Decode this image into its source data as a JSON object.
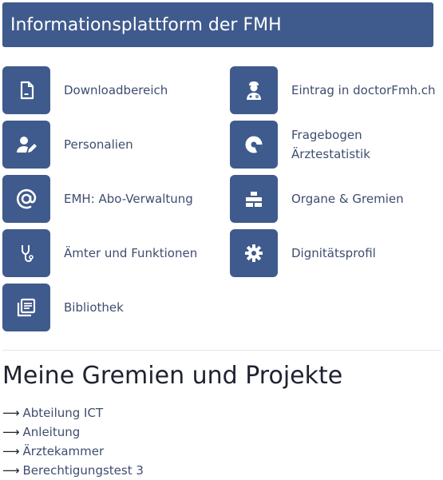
{
  "header": {
    "title": "Informationsplattform der FMH"
  },
  "tiles": [
    {
      "label": "Downloadbereich",
      "icon": "file-icon"
    },
    {
      "label": "Eintrag in doctorFmh.ch",
      "icon": "doctor-icon"
    },
    {
      "label": "Personalien",
      "icon": "user-edit-icon"
    },
    {
      "label": "Fragebogen\nÄrztestatistik",
      "icon": "pie-chart-icon"
    },
    {
      "label": "EMH: Abo-Verwaltung",
      "icon": "at-icon"
    },
    {
      "label": "Organe & Gremien",
      "icon": "org-chart-icon"
    },
    {
      "label": "Ämter und Funktionen",
      "icon": "stethoscope-icon"
    },
    {
      "label": "Dignitätsprofil",
      "icon": "gear-icon"
    },
    {
      "label": "Bibliothek",
      "icon": "library-icon"
    }
  ],
  "section": {
    "title": "Meine Gremien und Projekte",
    "arrow": "⟶",
    "links": [
      "Abteilung ICT",
      "Anleitung",
      "Ärztekammer",
      "Berechtigungstest 3"
    ]
  },
  "colors": {
    "accent": "#3f5a8c",
    "text": "#3f4d6e",
    "heading": "#1e2230"
  }
}
